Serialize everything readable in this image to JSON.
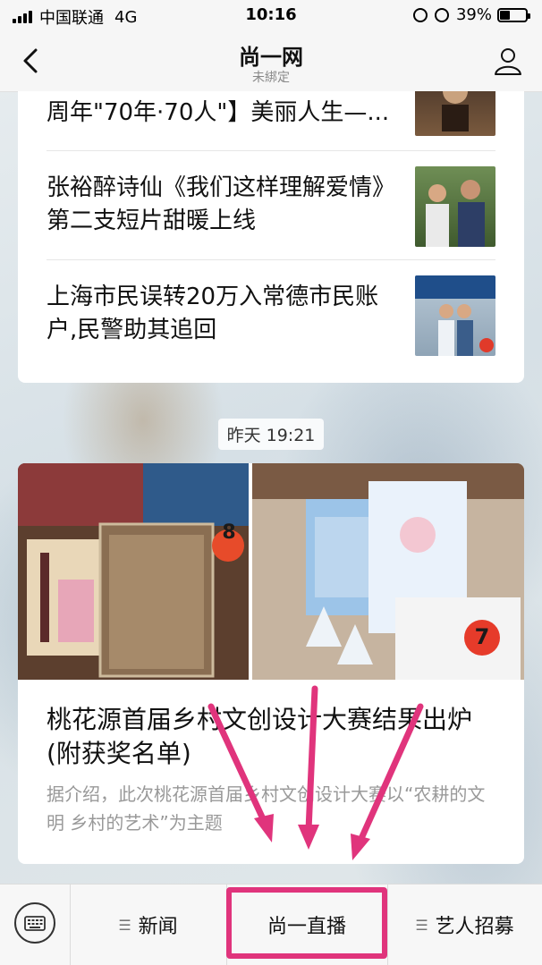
{
  "status_bar": {
    "carrier": "中国联通",
    "network": "4G",
    "time": "10:16",
    "battery": "39%",
    "battery_level": 0.39
  },
  "nav": {
    "title": "尚一网",
    "subtitle": "未綁定"
  },
  "news_items": [
    {
      "title": "周年\"70年·70人\"】美丽人生—..."
    },
    {
      "title": "张裕醉诗仙《我们这样理解爱情》第二支短片甜暖上线"
    },
    {
      "title": "上海市民误转20万入常德市民账户,民警助其追回"
    }
  ],
  "timestamp": "昨天 19:21",
  "article": {
    "badge_left": "8",
    "badge_right": "7",
    "title": "桃花源首届乡村文创设计大赛结果出炉(附获奖名单)",
    "desc": "据介绍，此次桃花源首届乡村文创设计大赛以“农耕的文明 乡村的艺术”为主题"
  },
  "bottom_menu": [
    {
      "label": "新闻"
    },
    {
      "label": "尚一直播"
    },
    {
      "label": "艺人招募"
    }
  ],
  "colors": {
    "highlight": "#e0347c",
    "arrow": "#e0347c"
  }
}
